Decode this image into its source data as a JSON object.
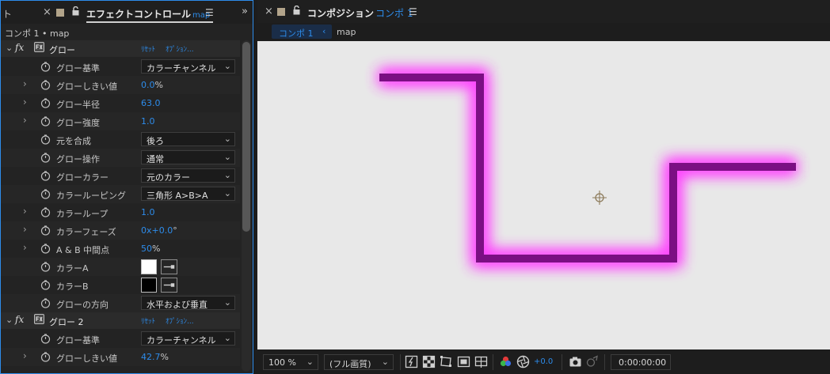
{
  "left_panel": {
    "tab_cut_label": "ト",
    "tab_title": "エフェクトコントロール",
    "tab_title_suffix": "map",
    "breadcrumb": "コンポ 1 • map",
    "effects": [
      {
        "name": "グロー",
        "reset": "ﾘｾｯﾄ",
        "options": "ｵﾌﾟｼｮﾝ...",
        "properties": [
          {
            "label": "グロー基準",
            "kind": "dropdown",
            "value": "カラーチャンネル"
          },
          {
            "label": "グローしきい値",
            "kind": "number",
            "value": "0.0",
            "unit": "%"
          },
          {
            "label": "グロー半径",
            "kind": "number",
            "value": "63.0",
            "unit": ""
          },
          {
            "label": "グロー強度",
            "kind": "number",
            "value": "1.0",
            "unit": ""
          },
          {
            "label": "元を合成",
            "kind": "dropdown",
            "value": "後ろ"
          },
          {
            "label": "グロー操作",
            "kind": "dropdown",
            "value": "通常"
          },
          {
            "label": "グローカラー",
            "kind": "dropdown",
            "value": "元のカラー"
          },
          {
            "label": "カラールーピング",
            "kind": "dropdown",
            "value": "三角形 A>B>A"
          },
          {
            "label": "カラーループ",
            "kind": "number",
            "value": "1.0",
            "unit": ""
          },
          {
            "label": "カラーフェーズ",
            "kind": "number",
            "value": "0x+0.0",
            "unit": "°"
          },
          {
            "label": "A & B 中間点",
            "kind": "number",
            "value": "50",
            "unit": "%"
          },
          {
            "label": "カラーA",
            "kind": "color",
            "color": "#ffffff"
          },
          {
            "label": "カラーB",
            "kind": "color",
            "color": "#000000"
          },
          {
            "label": "グローの方向",
            "kind": "dropdown",
            "value": "水平および垂直"
          }
        ]
      },
      {
        "name": "グロー 2",
        "reset": "ﾘｾｯﾄ",
        "options": "ｵﾌﾟｼｮﾝ...",
        "properties": [
          {
            "label": "グロー基準",
            "kind": "dropdown",
            "value": "カラーチャンネル"
          },
          {
            "label": "グローしきい値",
            "kind": "number",
            "value": "42.7",
            "unit": "%"
          }
        ]
      }
    ]
  },
  "composition": {
    "tab_title": "コンポジション",
    "tab_title_comp": "コンポ 1",
    "crumb_comp": "コンポ 1",
    "crumb_layer": "map",
    "viewer_bg": "#e8e8e8",
    "stroke_color": "#7b0f83",
    "glow_color": "#ff3cff",
    "bottom": {
      "zoom": "100 %",
      "quality": "(フル画質)",
      "exposure": "+0.0",
      "timecode": "0:00:00:00"
    }
  },
  "colors": {
    "accent": "#2d8ceb",
    "panel_bg": "#232323"
  }
}
